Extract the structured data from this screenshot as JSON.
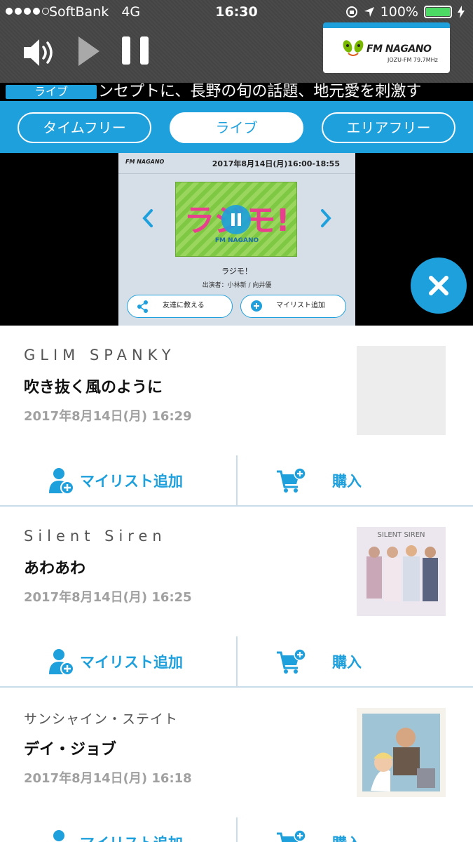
{
  "status_bar": {
    "carrier": "SoftBank",
    "network": "4G",
    "time": "16:30",
    "battery": "100%",
    "battery_level": 1.0
  },
  "station": {
    "name": "FM NAGANO",
    "frequency": "JOZU-FM 79.7MHz"
  },
  "ticker": {
    "badge": "ライブ",
    "text": "ンセプトに、長野の旬の話題、地元愛を刺激す"
  },
  "tabs": [
    {
      "label": "タイムフリー",
      "active": false
    },
    {
      "label": "ライブ",
      "active": true
    },
    {
      "label": "エリアフリー",
      "active": false
    }
  ],
  "now_playing": {
    "header_logo": "FM NAGANO",
    "broadcast_time": "2017年8月14日(月)16:00-18:55",
    "artwork_title": "ラジモ!",
    "artwork_subtitle": "FM NAGANO",
    "program_name": "ラジモ！",
    "performers": "出演者：小林新 / 向井優",
    "share_label": "友達に教える",
    "mylist_label": "マイリスト追加"
  },
  "tracks": [
    {
      "artist": "GLIM SPANKY",
      "title": "吹き抜く風のように",
      "played_at": "2017年8月14日(月) 16:29",
      "mylist_label": "マイリスト追加",
      "buy_label": "購入"
    },
    {
      "artist": "Silent Siren",
      "title": "あわあわ",
      "played_at": "2017年8月14日(月) 16:25",
      "jacket_text": "SILENT SIREN",
      "mylist_label": "マイリスト追加",
      "buy_label": "購入"
    },
    {
      "artist": "サンシャイン・ステイト",
      "title": "デイ・ジョブ",
      "played_at": "2017年8月14日(月) 16:18",
      "mylist_label": "マイリスト追加",
      "buy_label": "購入"
    }
  ],
  "colors": {
    "accent": "#1ea0dd",
    "header_bg": "#4a4a4a",
    "divider": "#c8dcea",
    "meta_text": "#a0a0a0"
  },
  "icons": {
    "volume": "volume-icon",
    "play": "play-icon",
    "pause": "pause-icon",
    "close": "close-icon",
    "mylist": "add-user-icon",
    "buy": "cart-add-icon"
  }
}
